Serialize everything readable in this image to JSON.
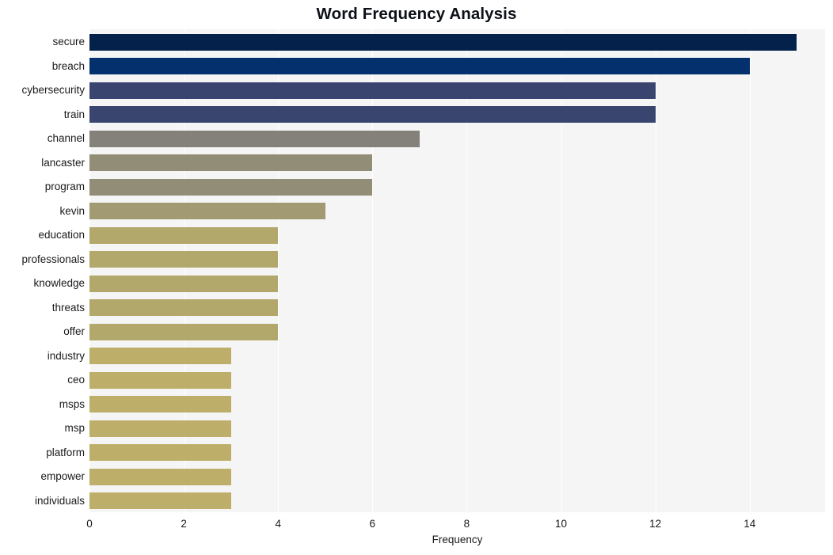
{
  "chart_data": {
    "type": "bar",
    "orientation": "horizontal",
    "title": "Word Frequency Analysis",
    "xlabel": "Frequency",
    "ylabel": "",
    "xlim": [
      0,
      15.6
    ],
    "xticks": [
      0,
      2,
      4,
      6,
      8,
      10,
      12,
      14
    ],
    "xtick_labels": [
      "0",
      "2",
      "4",
      "6",
      "8",
      "10",
      "12",
      "14"
    ],
    "grid": "vertical-only",
    "legend": "none",
    "categories": [
      "secure",
      "breach",
      "cybersecurity",
      "train",
      "channel",
      "lancaster",
      "program",
      "kevin",
      "education",
      "professionals",
      "knowledge",
      "threats",
      "offer",
      "industry",
      "ceo",
      "msps",
      "msp",
      "platform",
      "empower",
      "individuals"
    ],
    "values": [
      15,
      14,
      12,
      12,
      7,
      6,
      6,
      5,
      4,
      4,
      4,
      4,
      4,
      3,
      3,
      3,
      3,
      3,
      3,
      3
    ],
    "bar_colors": [
      "#04214b",
      "#04306e",
      "#39456f",
      "#39456f",
      "#84817b",
      "#928d77",
      "#928d77",
      "#a29a72",
      "#b3a86c",
      "#b3a86c",
      "#b3a86c",
      "#b3a86c",
      "#b3a86c",
      "#bdaf69",
      "#bdaf69",
      "#bdaf69",
      "#bdaf69",
      "#bdaf69",
      "#bdaf69",
      "#bdaf69"
    ],
    "plot_background": "#f5f5f6",
    "gridline_color": "#ffffff",
    "title_color": "#0d1117",
    "tick_color": "#1a1a1a"
  }
}
